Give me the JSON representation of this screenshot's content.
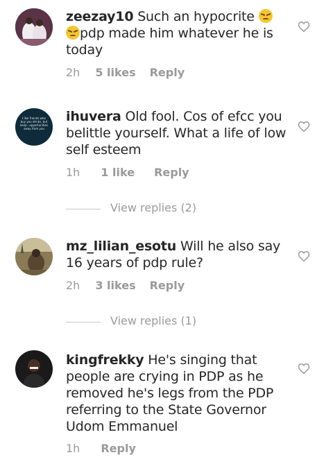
{
  "comments": [
    {
      "username": "zeezay10",
      "text_a": " Such an hypocrite ",
      "text_b": "pdp made him whatever he is today",
      "time": "2h",
      "likes": "5 likes",
      "reply": "Reply"
    },
    {
      "username": "ihuvera",
      "text": " Old fool. Cos of efcc you belittle yourself.  What a life of low self esteem",
      "time": "1h",
      "likes": "1 like",
      "reply": "Reply",
      "view_replies": "View replies (2)",
      "avatar_text": "I like friends who buy you drinks, but keep...opportunities away from you"
    },
    {
      "username": "mz_lilian_esotu",
      "text": " Will he also say 16 years of pdp rule?",
      "time": "2h",
      "likes": "3 likes",
      "reply": "Reply",
      "view_replies": "View replies (1)"
    },
    {
      "username": "kingfrekky",
      "text": " He's singing that people are crying in PDP as he removed he's legs from the PDP referring to the State Governor Udom Emmanuel",
      "time": "1h",
      "reply": "Reply"
    }
  ],
  "colors": {
    "text": "#262626",
    "muted": "#9a9a9a",
    "emoji": "#f7c531"
  },
  "icons": {
    "like": "heart-outline-icon",
    "emoji": "confounded-face-emoji"
  }
}
